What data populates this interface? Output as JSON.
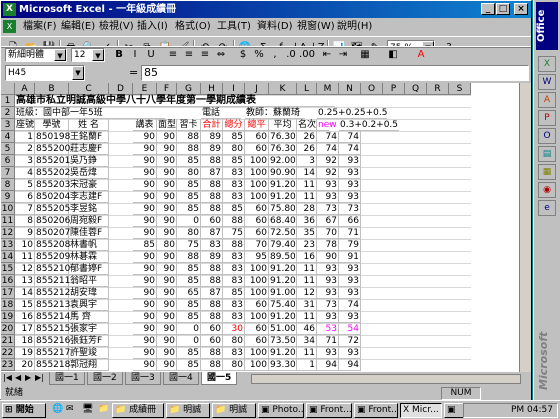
{
  "window": {
    "title": "Microsoft Excel - 一年級成績冊"
  },
  "menu": [
    "檔案(F)",
    "編輯(E)",
    "檢視(V)",
    "插入(I)",
    "格式(O)",
    "工具(T)",
    "資料(D)",
    "視窗(W)",
    "說明(H)"
  ],
  "toolbar": {
    "zoom": "75 %",
    "font_name": "新細明體",
    "font_size": "12"
  },
  "formula_bar": {
    "name_box": "H45",
    "equals": "=",
    "value": "85"
  },
  "columns": [
    "A",
    "B",
    "C",
    "D",
    "E",
    "F",
    "G",
    "H",
    "I",
    "J",
    "K",
    "L",
    "M",
    "N",
    "O",
    "P",
    "Q",
    "R",
    "S"
  ],
  "sheet": {
    "title": "高雄市私立明誠高級中學八十八學年度第一學期成績表",
    "class_label": "班級：國中部一年5班",
    "phone_label": "電話",
    "teacher_label": "教師：蘇蘭琦",
    "formula_note1": "0.25+0.25+0.5",
    "formula_note2_prefix": "new",
    "formula_note2": "0.3+0.2+0.5",
    "headers": [
      "座號",
      "學號",
      "姓 名",
      "講表",
      "面型",
      "習卡",
      "合計",
      "總分",
      "總平",
      "平均",
      "名次"
    ],
    "rows": [
      [
        "1",
        "850198",
        "王銘蘭F",
        "90",
        "90",
        "88",
        "89",
        "85",
        "60",
        "76.30",
        "26",
        "74",
        "74"
      ],
      [
        "2",
        "855200",
        "莊志慶F",
        "90",
        "90",
        "88",
        "89",
        "80",
        "60",
        "76.30",
        "26",
        "74",
        "74"
      ],
      [
        "3",
        "855201",
        "吳乃錚",
        "90",
        "90",
        "85",
        "88",
        "85",
        "100",
        "92.00",
        "3",
        "92",
        "93"
      ],
      [
        "4",
        "855202",
        "吳岳煒",
        "90",
        "90",
        "80",
        "87",
        "83",
        "100",
        "90.90",
        "14",
        "92",
        "93"
      ],
      [
        "5",
        "855203",
        "宋冠豪",
        "90",
        "90",
        "85",
        "88",
        "83",
        "100",
        "91.20",
        "11",
        "93",
        "93"
      ],
      [
        "6",
        "850204",
        "李志建F",
        "90",
        "90",
        "85",
        "88",
        "83",
        "100",
        "91.20",
        "11",
        "93",
        "93"
      ],
      [
        "7",
        "855205",
        "李昱銘",
        "90",
        "90",
        "85",
        "88",
        "85",
        "60",
        "75.80",
        "28",
        "73",
        "73"
      ],
      [
        "8",
        "850206",
        "周宛毅F",
        "90",
        "90",
        "0",
        "60",
        "88",
        "60",
        "68.40",
        "36",
        "67",
        "66"
      ],
      [
        "9",
        "850207",
        "陳佳蓉F",
        "90",
        "90",
        "80",
        "87",
        "75",
        "60",
        "72.50",
        "35",
        "70",
        "71"
      ],
      [
        "10",
        "855208",
        "林書帆",
        "85",
        "80",
        "75",
        "83",
        "88",
        "70",
        "79.40",
        "23",
        "78",
        "79"
      ],
      [
        "11",
        "855209",
        "林碁霖",
        "90",
        "90",
        "88",
        "89",
        "83",
        "95",
        "89.50",
        "16",
        "90",
        "91"
      ],
      [
        "12",
        "855210",
        "郁書婷F",
        "90",
        "90",
        "85",
        "88",
        "83",
        "100",
        "91.20",
        "11",
        "93",
        "93"
      ],
      [
        "13",
        "855211",
        "翁昭平",
        "90",
        "90",
        "85",
        "88",
        "83",
        "100",
        "91.20",
        "11",
        "93",
        "93"
      ],
      [
        "14",
        "855212",
        "胡安瑋",
        "90",
        "90",
        "65",
        "87",
        "85",
        "100",
        "91.00",
        "12",
        "93",
        "93"
      ],
      [
        "15",
        "855213",
        "袁興宇",
        "90",
        "90",
        "85",
        "88",
        "83",
        "60",
        "75.40",
        "31",
        "73",
        "74"
      ],
      [
        "16",
        "855214",
        "馬 齊",
        "90",
        "90",
        "85",
        "88",
        "83",
        "100",
        "91.20",
        "11",
        "93",
        "93"
      ],
      [
        "17",
        "855215",
        "張家宇",
        "90",
        "90",
        "0",
        "60",
        "30",
        "60",
        "51.00",
        "46",
        "53",
        "54"
      ],
      [
        "18",
        "855216",
        "張鈺芳F",
        "90",
        "90",
        "0",
        "60",
        "80",
        "60",
        "73.50",
        "34",
        "71",
        "72"
      ],
      [
        "19",
        "855217",
        "許聖竣",
        "90",
        "90",
        "85",
        "88",
        "83",
        "100",
        "91.20",
        "11",
        "93",
        "93"
      ],
      [
        "20",
        "855218",
        "郭冠翔",
        "90",
        "90",
        "85",
        "88",
        "80",
        "100",
        "93.30",
        "1",
        "94",
        "94"
      ],
      [
        "21",
        "855219",
        "陳觀毅",
        "90",
        "90",
        "0",
        "60",
        "90",
        "100",
        "77.00",
        "24",
        "80",
        "80"
      ],
      [
        "22",
        "855220",
        "陳鶴寧F",
        "90",
        "90",
        "0",
        "60",
        "85",
        "60",
        "66.00",
        "41",
        "67",
        "65"
      ],
      [
        "23",
        "855221",
        "陳立民",
        "0",
        "90",
        "0",
        "30",
        "70",
        "60",
        "54.00",
        "45",
        "55",
        "53"
      ],
      [
        "24",
        "855222",
        "陳宜祐",
        "80",
        "90",
        "0",
        "57",
        "85",
        "60",
        "65.10",
        "42",
        "65",
        "64"
      ]
    ]
  },
  "sheet_tabs": [
    "國一1",
    "國一2",
    "國一3",
    "國一4",
    "國一5"
  ],
  "status": {
    "left": "就緒",
    "num": "NUM"
  },
  "office_bar": {
    "label": "Office",
    "brand": "Microsoft"
  },
  "taskbar": {
    "start": "開始",
    "tasks": [
      "成績冊",
      "明誠",
      "明誠",
      "Photo...",
      "Front...",
      "Front...",
      "Micr...",
      ""
    ],
    "clock": "PM 04:57"
  }
}
